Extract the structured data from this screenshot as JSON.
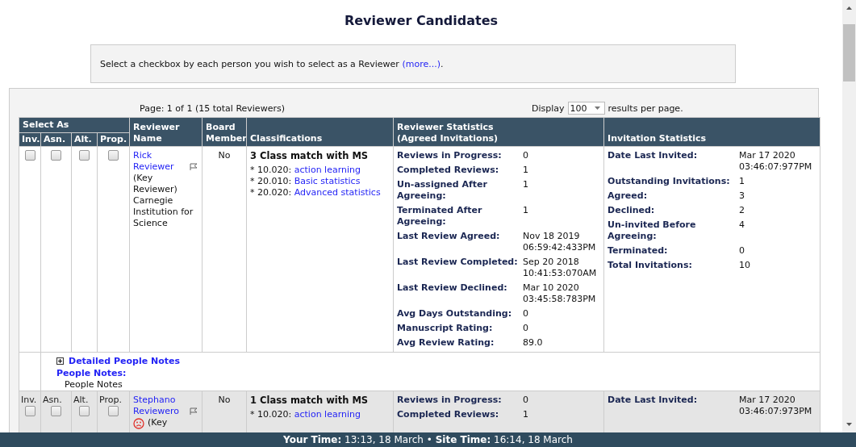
{
  "title": "Reviewer Candidates",
  "instructions": {
    "text": "Select a checkbox by each person you wish to select as a Reviewer ",
    "link": "(more...)",
    "after": "."
  },
  "pagination": {
    "summary": "Page: 1 of 1 (15 total Reviewers)",
    "display_label": "Display",
    "per_page": "100",
    "suffix": "results per page."
  },
  "table": {
    "group_heading": "Select As",
    "select_columns": [
      "Inv.",
      "Asn.",
      "Alt.",
      "Prop."
    ],
    "columns": [
      "Reviewer Name",
      "Board Member",
      "Classifications",
      "Reviewer Statistics (Agreed Invitations)",
      "Invitation Statistics"
    ],
    "rows": [
      {
        "shaded": false,
        "checkbox_labels": [],
        "checkboxes": [
          {
            "checked": false
          },
          {
            "checked": false
          },
          {
            "checked": false
          },
          {
            "checked": false
          }
        ],
        "name": "Rick Reviewer",
        "flagged": true,
        "unhappy": false,
        "details": "(Key Reviewer) Carnegie Institution for Science",
        "board_member": "No",
        "match": "3 Class match with MS",
        "classifications": [
          {
            "code": "* 10.020: ",
            "label": "action learning"
          },
          {
            "code": "* 20.010: ",
            "label": "Basic statistics"
          },
          {
            "code": "* 20.020: ",
            "label": "Advanced statistics"
          }
        ],
        "reviewer_stats": [
          {
            "label": "Reviews in Progress:",
            "value": "0"
          },
          {
            "label": "Completed Reviews:",
            "value": "1"
          },
          {
            "label": "Un-assigned After Agreeing:",
            "value": "1"
          },
          {
            "label": "Terminated After Agreeing:",
            "value": "1"
          },
          {
            "label": "Last Review Agreed:",
            "value": "Nov 18 2019 06:59:42:433PM"
          },
          {
            "label": "Last Review Completed:",
            "value": "Sep 20 2018 10:41:53:070AM"
          },
          {
            "label": "Last Review Declined:",
            "value": "Mar 10 2020 03:45:58:783PM"
          },
          {
            "label": "Avg Days Outstanding:",
            "value": "0"
          },
          {
            "label": "Manuscript Rating:",
            "value": "0"
          },
          {
            "label": "Avg Review Rating:",
            "value": "89.0"
          }
        ],
        "invitation_stats": [
          {
            "label": "Date Last Invited:",
            "value": "Mar 17 2020 03:46:07:977PM"
          },
          {
            "label": "Outstanding Invitations:",
            "value": "1"
          },
          {
            "label": "Agreed:",
            "value": "3"
          },
          {
            "label": "Declined:",
            "value": "2"
          },
          {
            "label": "Un-invited Before Agreeing:",
            "value": "4"
          },
          {
            "label": "Terminated:",
            "value": "0"
          },
          {
            "label": "Total Invitations:",
            "value": "10"
          }
        ],
        "notes": {
          "expanded": false,
          "toggle": "Detailed People Notes",
          "heading": "People Notes:",
          "text": "People Notes"
        }
      },
      {
        "shaded": true,
        "checkbox_labels": [
          "Inv.",
          "Asn.",
          "Alt.",
          "Prop."
        ],
        "checkboxes": [
          {
            "checked": false
          },
          {
            "checked": false
          },
          {
            "checked": false
          },
          {
            "checked": false
          }
        ],
        "name": "Stephano Reviewero",
        "flagged": true,
        "unhappy": true,
        "details": "(Key",
        "board_member": "No",
        "match": "1 Class match with MS",
        "classifications": [
          {
            "code": "* 10.020: ",
            "label": "action learning"
          }
        ],
        "reviewer_stats": [
          {
            "label": "Reviews in Progress:",
            "value": "0"
          },
          {
            "label": "Completed Reviews:",
            "value": "1"
          }
        ],
        "invitation_stats": [
          {
            "label": "Date Last Invited:",
            "value": "Mar 17 2020 03:46:07:973PM"
          }
        ]
      }
    ]
  },
  "footer": {
    "your_time_label": "Your Time:",
    "your_time": "13:13, 18 March",
    "separator": "•",
    "site_time_label": "Site Time:",
    "site_time": "16:14, 18 March"
  }
}
